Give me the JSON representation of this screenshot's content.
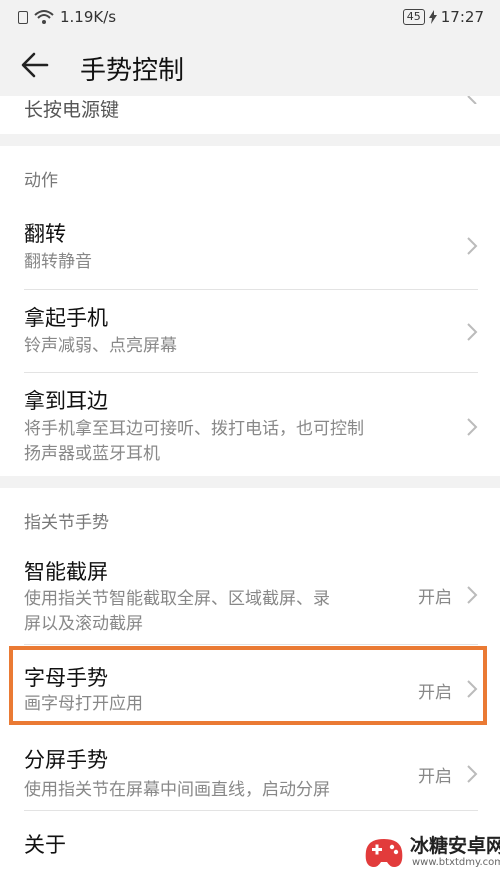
{
  "status_bar": {
    "net_speed": "1.19K/s",
    "battery": "45",
    "time": "17:27"
  },
  "header": {
    "title": "手势控制"
  },
  "prev_item": {
    "subtitle": "长按电源键"
  },
  "sections": {
    "actions": {
      "header": "动作",
      "items": [
        {
          "title": "翻转",
          "subtitle": "翻转静音"
        },
        {
          "title": "拿起手机",
          "subtitle": "铃声减弱、点亮屏幕"
        },
        {
          "title": "拿到耳边",
          "subtitle_line1": "将手机拿至耳边可接听、拨打电话，也可控制",
          "subtitle_line2": "扬声器或蓝牙耳机"
        }
      ]
    },
    "knuckle": {
      "header": "指关节手势",
      "items": [
        {
          "title": "智能截屏",
          "subtitle_line1": "使用指关节智能截取全屏、区域截屏、录",
          "subtitle_line2": "屏以及滚动截屏",
          "status": "开启"
        },
        {
          "title": "字母手势",
          "subtitle": "画字母打开应用",
          "status": "开启"
        },
        {
          "title": "分屏手势",
          "subtitle": "使用指关节在屏幕中间画直线，启动分屏",
          "status": "开启"
        },
        {
          "title": "关于"
        }
      ]
    }
  },
  "watermark": {
    "text": "冰糖安卓网",
    "url": "www.btxtdmy.com"
  },
  "colors": {
    "background": "#f2f2f2",
    "card": "#ffffff",
    "highlight_border": "#ea7a34"
  }
}
